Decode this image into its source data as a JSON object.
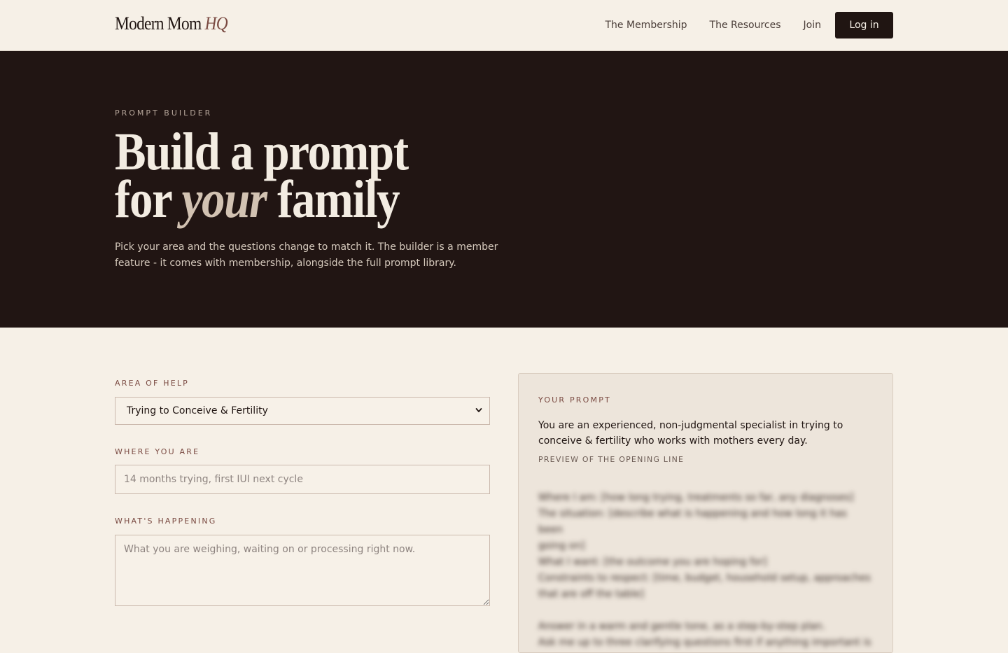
{
  "header": {
    "logo_main": "Modern Mom",
    "logo_accent": "HQ",
    "nav": [
      {
        "label": "The Membership"
      },
      {
        "label": "The Resources"
      },
      {
        "label": "Join"
      }
    ],
    "login_label": "Log in"
  },
  "hero": {
    "eyebrow": "PROMPT BUILDER",
    "title_line1": "Build a prompt",
    "title_line2_pre": "for ",
    "title_line2_em": "your",
    "title_line2_post": " family",
    "subtitle": "Pick your area and the questions change to match it. The builder is a member feature - it comes with membership, alongside the full prompt library."
  },
  "form": {
    "area_label": "AREA OF HELP",
    "area_value": "Trying to Conceive & Fertility",
    "where_label": "WHERE YOU ARE",
    "where_placeholder": "14 months trying, first IUI next cycle",
    "happening_label": "WHAT'S HAPPENING",
    "happening_placeholder": "What you are weighing, waiting on or processing right now."
  },
  "prompt_panel": {
    "eyebrow": "YOUR PROMPT",
    "intro": "You are an experienced, non-judgmental specialist in trying to conceive & fertility who works with mothers every day.",
    "preview_label": "PREVIEW OF THE OPENING LINE",
    "blurred_lines": [
      "Where I am: [how long trying, treatments so far, any diagnoses]",
      "The situation: [describe what is happening and how long it has been",
      "going on]",
      "What I want: [the outcome you are hoping for]",
      "Constraints to respect: [time, budget, household setup, approaches",
      "that are off the table]",
      "",
      "Answer in a warm and gentle tone, as a step-by-step plan.",
      "Ask me up to three clarifying questions first if anything important is"
    ]
  }
}
